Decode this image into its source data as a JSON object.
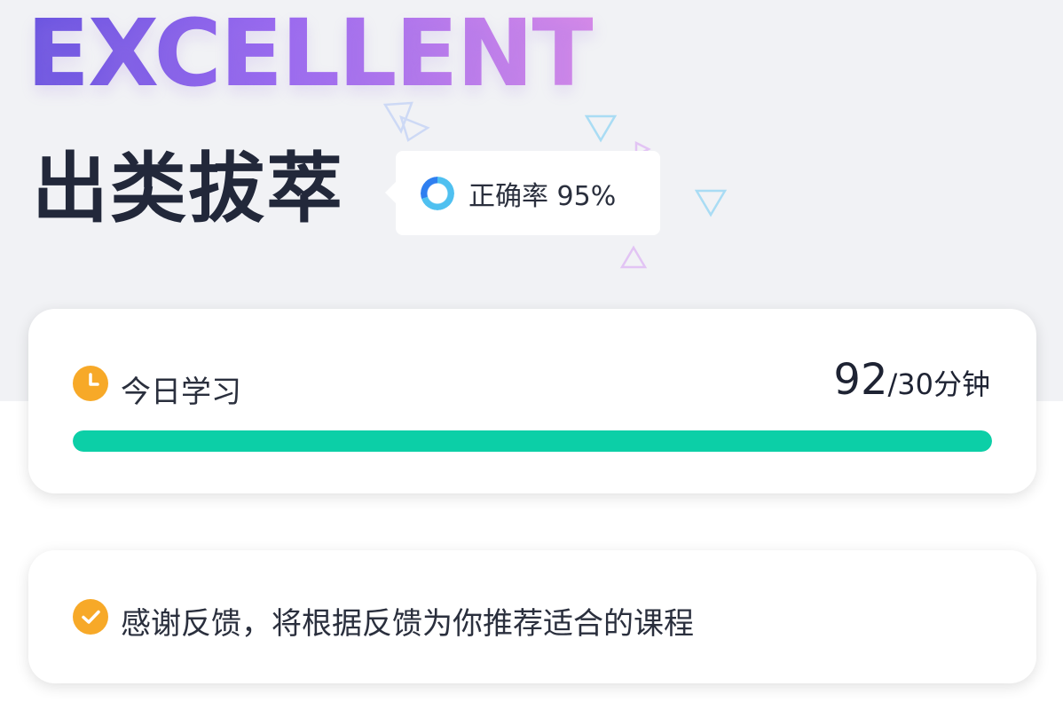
{
  "hero": {
    "banner": "EXCELLENT",
    "headline": "出类拔萃",
    "accuracy_text": "正确率 95%",
    "accuracy_value": 0.95
  },
  "study": {
    "label": "今日学习",
    "minutes": "92",
    "goal_text": "/30分钟",
    "progress": 1.0
  },
  "feedback": {
    "message": "感谢反馈，将根据反馈为你推荐适合的课程"
  },
  "icons": {
    "accuracy": "donut-chart-icon",
    "study": "clock-icon",
    "feedback": "check-circle-icon"
  },
  "colors": {
    "accent_orange": "#f7a928",
    "progress_fill": "#0ccfa7",
    "banner_gradient_start": "#6a55e0",
    "banner_gradient_end": "#d68ae8"
  }
}
